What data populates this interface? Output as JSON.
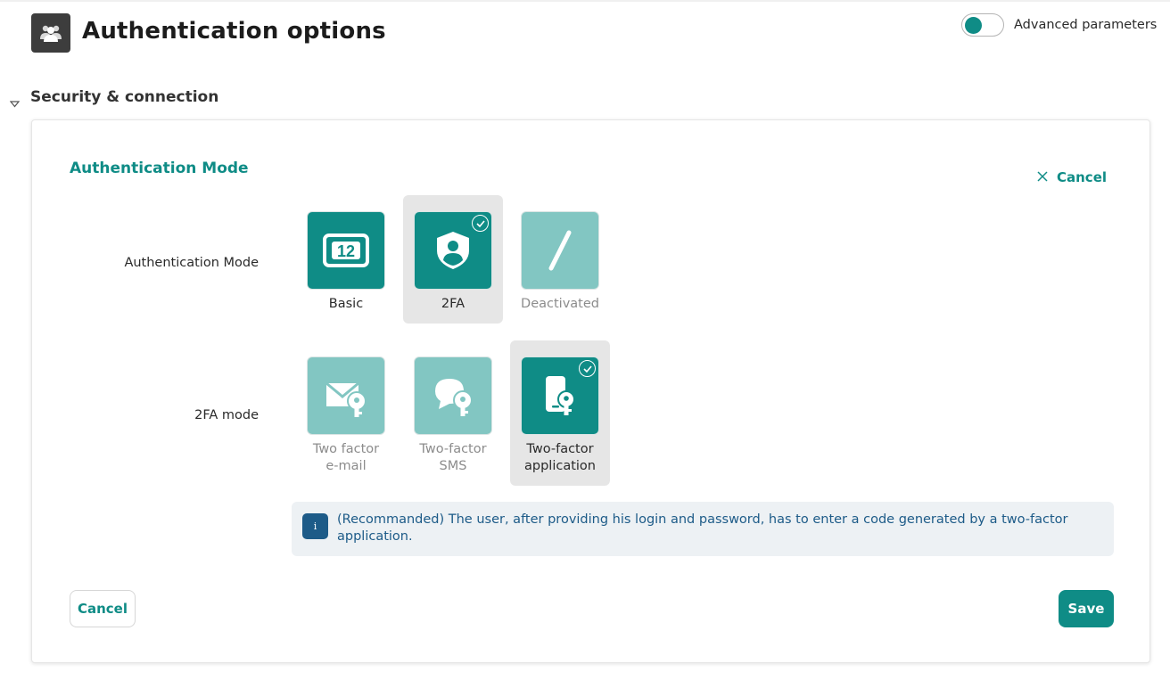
{
  "header": {
    "title": "Authentication options",
    "icon": "users-icon",
    "advanced_label": "Advanced parameters",
    "advanced_enabled": false
  },
  "section": {
    "title": "Security & connection",
    "expanded": true
  },
  "panel": {
    "title": "Authentication Mode",
    "cancel_link": "Cancel",
    "auth_mode": {
      "label": "Authentication Mode",
      "options": [
        {
          "label": "Basic",
          "icon": "keypad-code-icon",
          "selected": false,
          "enabled": true
        },
        {
          "label": "2FA",
          "icon": "shield-user-icon",
          "selected": true,
          "enabled": true
        },
        {
          "label": "Deactivated",
          "icon": "slash-icon",
          "selected": false,
          "enabled": false
        }
      ]
    },
    "twofa_mode": {
      "label": "2FA mode",
      "options": [
        {
          "label_line1": "Two factor",
          "label_line2": "e-mail",
          "icon": "mail-key-icon",
          "selected": false
        },
        {
          "label_line1": "Two-factor",
          "label_line2": "SMS",
          "icon": "chat-key-icon",
          "selected": false
        },
        {
          "label_line1": "Two-factor",
          "label_line2": "application",
          "icon": "phone-key-icon",
          "selected": true
        }
      ]
    },
    "info": {
      "icon_glyph": "i",
      "text": "(Recommanded) The user, after providing his login and password, has to enter a code generated by a two-factor application."
    },
    "buttons": {
      "cancel": "Cancel",
      "save": "Save"
    }
  },
  "colors": {
    "accent": "#0f8c86",
    "accent_light": "#82c6c2",
    "info_text": "#1d5b88",
    "info_bg": "#edf1f4"
  }
}
